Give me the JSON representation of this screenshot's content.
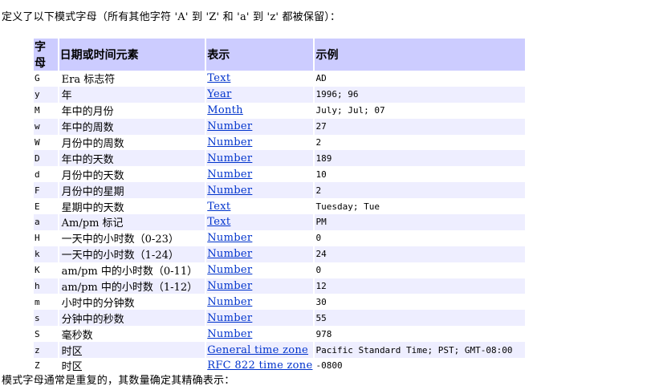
{
  "intro_text": "定义了以下模式字母（所有其他字符 'A' 到 'Z' 和 'a' 到 'z' 都被保留）：",
  "table": {
    "headers": {
      "letter": "字母",
      "element": "日期或时间元素",
      "presentation": "表示",
      "example": "示例"
    },
    "rows": [
      {
        "letter": "G",
        "element": "Era 标志符",
        "presentation": "Text",
        "example": "AD"
      },
      {
        "letter": "y",
        "element": "年",
        "presentation": "Year",
        "example": "1996; 96"
      },
      {
        "letter": "M",
        "element": "年中的月份",
        "presentation": "Month",
        "example": "July; Jul; 07"
      },
      {
        "letter": "w",
        "element": "年中的周数",
        "presentation": "Number",
        "example": "27"
      },
      {
        "letter": "W",
        "element": "月份中的周数",
        "presentation": "Number",
        "example": "2"
      },
      {
        "letter": "D",
        "element": "年中的天数",
        "presentation": "Number",
        "example": "189"
      },
      {
        "letter": "d",
        "element": "月份中的天数",
        "presentation": "Number",
        "example": "10"
      },
      {
        "letter": "F",
        "element": "月份中的星期",
        "presentation": "Number",
        "example": "2"
      },
      {
        "letter": "E",
        "element": "星期中的天数",
        "presentation": "Text",
        "example": "Tuesday; Tue"
      },
      {
        "letter": "a",
        "element": "Am/pm 标记",
        "presentation": "Text",
        "example": "PM"
      },
      {
        "letter": "H",
        "element": "一天中的小时数（0-23）",
        "presentation": "Number",
        "example": "0"
      },
      {
        "letter": "k",
        "element": "一天中的小时数（1-24）",
        "presentation": "Number",
        "example": "24"
      },
      {
        "letter": "K",
        "element": "am/pm 中的小时数（0-11）",
        "presentation": "Number",
        "example": "0"
      },
      {
        "letter": "h",
        "element": "am/pm 中的小时数（1-12）",
        "presentation": "Number",
        "example": "12"
      },
      {
        "letter": "m",
        "element": "小时中的分钟数",
        "presentation": "Number",
        "example": "30"
      },
      {
        "letter": "s",
        "element": "分钟中的秒数",
        "presentation": "Number",
        "example": "55"
      },
      {
        "letter": "S",
        "element": "毫秒数",
        "presentation": "Number",
        "example": "978"
      },
      {
        "letter": "z",
        "element": "时区",
        "presentation": "General time zone",
        "example": "Pacific Standard Time; PST; GMT-08:00"
      },
      {
        "letter": "Z",
        "element": "时区",
        "presentation": "RFC 822 time zone",
        "example": "-0800"
      }
    ]
  },
  "outro_text": "模式字母通常是重复的，其数量确定其精确表示：",
  "colors": {
    "header_bg": "#ccccff",
    "alt_row_bg": "#eeeeff",
    "link": "#0033cc"
  }
}
